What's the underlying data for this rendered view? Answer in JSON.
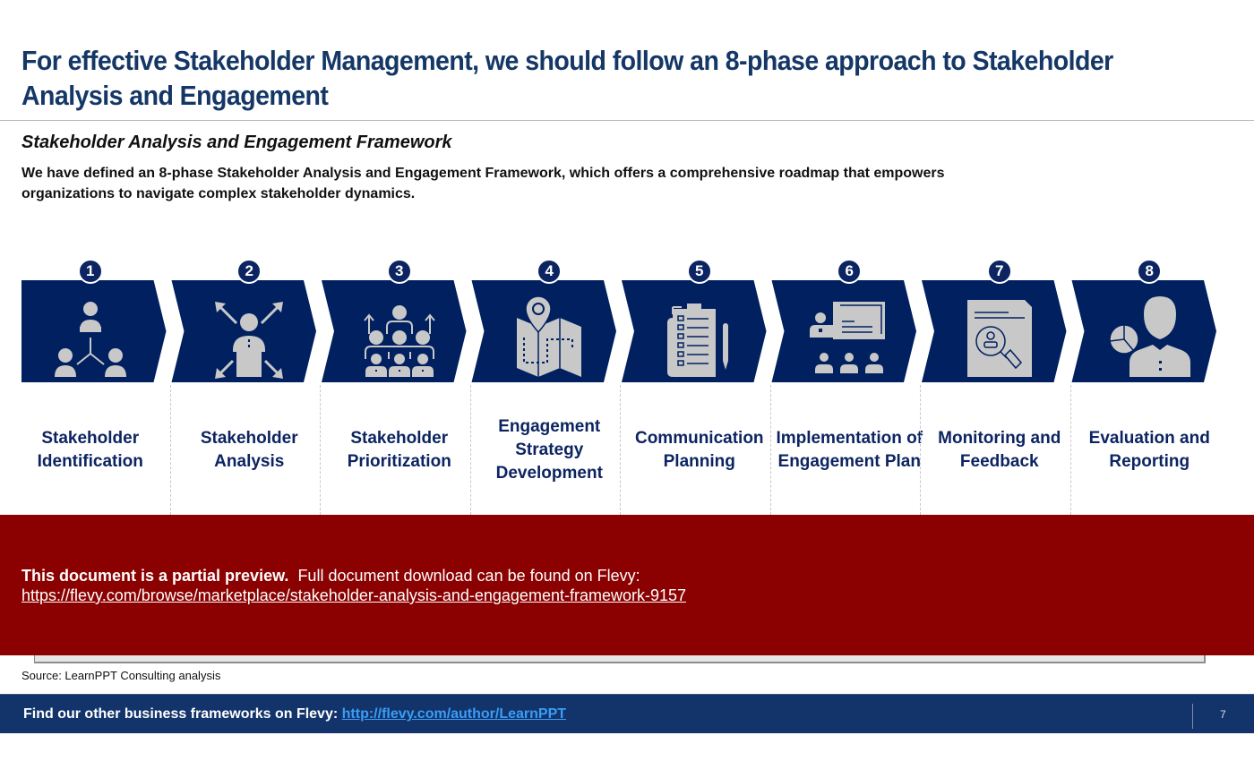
{
  "header": {
    "title_line1": "For effective Stakeholder Management, we should follow an 8-phase approach to Stakeholder",
    "title_line2": "Analysis and Engagement"
  },
  "section": {
    "subtitle": "Stakeholder Analysis and Engagement Framework",
    "description_line1": "We have defined an 8-phase Stakeholder Analysis and Engagement Framework, which offers a comprehensive roadmap that empowers",
    "description_line2": "organizations to navigate complex stakeholder dynamics."
  },
  "colors": {
    "chevron": "#002060",
    "icon": "#c8c8c8",
    "title": "#153766",
    "preview_bg": "#8b0000",
    "footer_bg": "#12346a",
    "link": "#3b9cf5"
  },
  "phases": [
    {
      "number": "1",
      "label": "Stakeholder Identification",
      "icon": "stakeholder-network-icon"
    },
    {
      "number": "2",
      "label": "Stakeholder Analysis",
      "icon": "person-arrows-icon"
    },
    {
      "number": "3",
      "label": "Stakeholder Prioritization",
      "icon": "group-hierarchy-icon"
    },
    {
      "number": "4",
      "label": "Engagement Strategy Development",
      "icon": "map-pin-icon"
    },
    {
      "number": "5",
      "label": "Communication Planning",
      "icon": "checklist-clipboard-icon"
    },
    {
      "number": "6",
      "label": "Implementation of Engagement Plan",
      "icon": "presentation-audience-icon"
    },
    {
      "number": "7",
      "label": "Monitoring and Feedback",
      "icon": "document-search-icon"
    },
    {
      "number": "8",
      "label": "Evaluation and Reporting",
      "icon": "person-pie-chart-icon"
    }
  ],
  "preview": {
    "bold_text": "This document is a partial preview.",
    "text": "Full document download can be found on Flevy:",
    "link": "https://flevy.com/browse/marketplace/stakeholder-analysis-and-engagement-framework-9157"
  },
  "source": "Source: LearnPPT Consulting analysis",
  "footer": {
    "text": "Find our other business frameworks on Flevy:",
    "link": "http://flevy.com/author/LearnPPT",
    "page_number": "7"
  }
}
